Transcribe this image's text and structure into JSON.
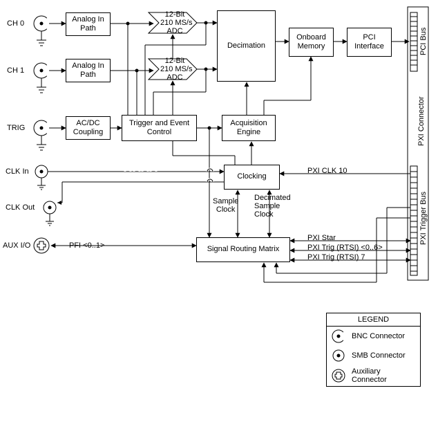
{
  "inputs": {
    "ch0": "CH 0",
    "ch1": "CH 1",
    "trig": "TRIG",
    "clk_in": "CLK In",
    "clk_out": "CLK Out",
    "aux_io": "AUX I/O",
    "pfi": "PFI <0..1>"
  },
  "blocks": {
    "analog_in_path": "Analog In\nPath",
    "adc": "12-Bit\n210 MS/s\nADC",
    "decimation": "Decimation",
    "onboard_memory": "Onboard\nMemory",
    "pci_interface": "PCI\nInterface",
    "acdc_coupling": "AC/DC\nCoupling",
    "trigger_event": "Trigger and\nEvent Control",
    "acquisition_engine": "Acquisition\nEngine",
    "clocking": "Clocking",
    "signal_routing": "Signal Routing\nMatrix"
  },
  "connectors": {
    "pci_bus": "PCI Bus",
    "pxi_connector": "PXI Connector",
    "pxi_trigger_bus": "PXI Trigger Bus"
  },
  "signals": {
    "pxi_clk10": "PXI CLK 10",
    "sample_clock": "Sample\nClock",
    "decimated_sample_clock": "Decimated\nSample\nClock",
    "pxi_star": "PXI Star",
    "pxi_trig_rtsi_06": "PXI Trig (RTSI) <0..6>",
    "pxi_trig_rtsi_7": "PXI Trig (RTSI) 7"
  },
  "legend": {
    "title": "LEGEND",
    "bnc": "BNC\nConnector",
    "smb": "SMB\nConnector",
    "aux": "Auxiliary\nConnector"
  }
}
